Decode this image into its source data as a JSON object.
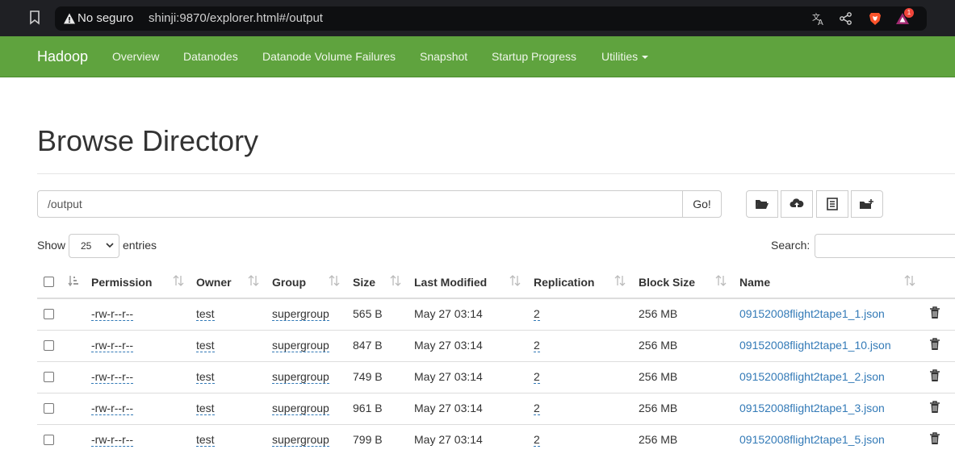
{
  "browser": {
    "insecure_label": "No seguro",
    "url": "shinji:9870/explorer.html#/output",
    "notification_count": "1"
  },
  "navbar": {
    "brand": "Hadoop",
    "items": [
      {
        "label": "Overview"
      },
      {
        "label": "Datanodes"
      },
      {
        "label": "Datanode Volume Failures"
      },
      {
        "label": "Snapshot"
      },
      {
        "label": "Startup Progress"
      },
      {
        "label": "Utilities"
      }
    ],
    "color": "#5fa33e"
  },
  "page": {
    "title": "Browse Directory",
    "path_value": "/output",
    "go_label": "Go!",
    "show_label": "Show",
    "entries_value": "25",
    "entries_label": "entries",
    "search_label": "Search:"
  },
  "table": {
    "columns": [
      "Permission",
      "Owner",
      "Group",
      "Size",
      "Last Modified",
      "Replication",
      "Block Size",
      "Name"
    ],
    "rows": [
      {
        "permission": "-rw-r--r--",
        "owner": "test",
        "group": "supergroup",
        "size": "565 B",
        "modified": "May 27 03:14",
        "replication": "2",
        "block_size": "256 MB",
        "name": "09152008flight2tape1_1.json"
      },
      {
        "permission": "-rw-r--r--",
        "owner": "test",
        "group": "supergroup",
        "size": "847 B",
        "modified": "May 27 03:14",
        "replication": "2",
        "block_size": "256 MB",
        "name": "09152008flight2tape1_10.json"
      },
      {
        "permission": "-rw-r--r--",
        "owner": "test",
        "group": "supergroup",
        "size": "749 B",
        "modified": "May 27 03:14",
        "replication": "2",
        "block_size": "256 MB",
        "name": "09152008flight2tape1_2.json"
      },
      {
        "permission": "-rw-r--r--",
        "owner": "test",
        "group": "supergroup",
        "size": "961 B",
        "modified": "May 27 03:14",
        "replication": "2",
        "block_size": "256 MB",
        "name": "09152008flight2tape1_3.json"
      },
      {
        "permission": "-rw-r--r--",
        "owner": "test",
        "group": "supergroup",
        "size": "799 B",
        "modified": "May 27 03:14",
        "replication": "2",
        "block_size": "256 MB",
        "name": "09152008flight2tape1_5.json"
      }
    ]
  }
}
